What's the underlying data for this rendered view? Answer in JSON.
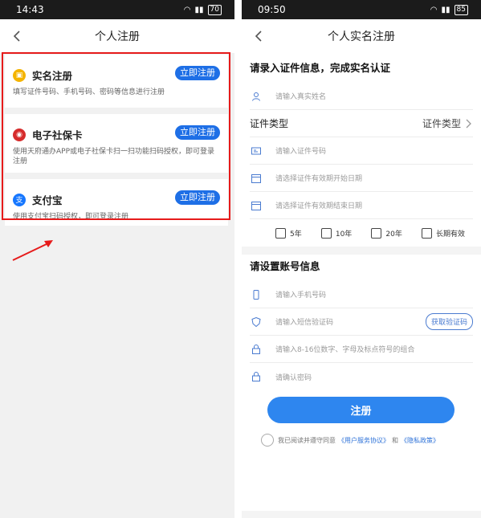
{
  "left": {
    "status": {
      "time": "14:43",
      "battery": "70"
    },
    "nav_title": "个人注册",
    "cards": [
      {
        "title": "实名注册",
        "button": "立即注册",
        "desc": "填写证件号码、手机号码、密码等信息进行注册",
        "icon": "id-card-icon"
      },
      {
        "title": "电子社保卡",
        "button": "立即注册",
        "desc": "使用天府通办APP或电子社保卡扫一扫功能扫码授权，即可登录注册",
        "icon": "social-security-icon"
      },
      {
        "title": "支付宝",
        "button": "立即注册",
        "desc": "使用支付宝扫码授权，即可登录注册",
        "icon": "alipay-icon"
      }
    ]
  },
  "right": {
    "status": {
      "time": "09:50",
      "battery": "85"
    },
    "nav_title": "个人实名注册",
    "section1_title": "请录入证件信息，完成实名认证",
    "name_placeholder": "请输入真实姓名",
    "cert_type_label": "证件类型",
    "cert_type_value": "证件类型",
    "cert_no_placeholder": "请输入证件号码",
    "start_date_placeholder": "请选择证件有效期开始日期",
    "end_date_placeholder": "请选择证件有效期结束日期",
    "validity_options": [
      "5年",
      "10年",
      "20年",
      "长期有效"
    ],
    "section2_title": "请设置账号信息",
    "phone_placeholder": "请输入手机号码",
    "sms_placeholder": "请输入短信验证码",
    "get_code_label": "获取验证码",
    "password_placeholder": "请输入8-16位数字、字母及标点符号的组合",
    "confirm_placeholder": "请确认密码",
    "submit_label": "注册",
    "agree_prefix": "我已阅读并遵守同意",
    "agree_link1": "《用户服务协议》",
    "agree_and": "和",
    "agree_link2": "《隐私政策》"
  },
  "colors": {
    "accent": "#1e6fe6",
    "highlight_box": "#e61b1b",
    "submit": "#2e86ef"
  }
}
